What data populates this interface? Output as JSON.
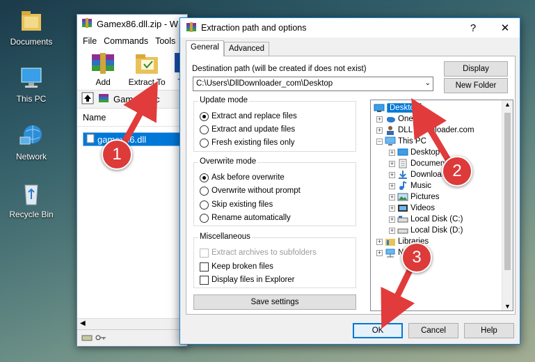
{
  "desktop": {
    "icons": [
      {
        "label": "Documents",
        "icon": "folder-icon"
      },
      {
        "label": "This PC",
        "icon": "computer-icon"
      },
      {
        "label": "Network",
        "icon": "network-icon"
      },
      {
        "label": "Recycle Bin",
        "icon": "recycle-bin-icon"
      }
    ]
  },
  "winrar": {
    "title": "Gamex86.dll.zip - W",
    "menu": [
      "File",
      "Commands",
      "Tools"
    ],
    "toolbar": [
      "Add",
      "Extract To",
      "T"
    ],
    "address": "Gamex86.c",
    "column_name": "Name",
    "file": "gamex86.dll"
  },
  "dialog": {
    "title": "Extraction path and options",
    "help_btn": "?",
    "close_btn": "✕",
    "tabs": [
      "General",
      "Advanced"
    ],
    "dest_label": "Destination path (will be created if does not exist)",
    "dest_value": "C:\\Users\\DllDownloader_com\\Desktop",
    "display_btn": "Display",
    "new_folder_btn": "New Folder",
    "update_mode": {
      "title": "Update mode",
      "options": [
        "Extract and replace files",
        "Extract and update files",
        "Fresh existing files only"
      ],
      "selected": 0
    },
    "overwrite_mode": {
      "title": "Overwrite mode",
      "options": [
        "Ask before overwrite",
        "Overwrite without prompt",
        "Skip existing files",
        "Rename automatically"
      ],
      "selected": 0
    },
    "misc": {
      "title": "Miscellaneous",
      "options": [
        "Extract archives to subfolders",
        "Keep broken files",
        "Display files in Explorer"
      ]
    },
    "save_settings": "Save settings",
    "tree": [
      {
        "label": "Desktop",
        "depth": 0,
        "selected": true
      },
      {
        "label": "OneDrive",
        "depth": 1
      },
      {
        "label": "DLL Downloader.com",
        "depth": 1
      },
      {
        "label": "This PC",
        "depth": 1
      },
      {
        "label": "Desktop",
        "depth": 2
      },
      {
        "label": "Documents",
        "depth": 2
      },
      {
        "label": "Downloads",
        "depth": 2
      },
      {
        "label": "Music",
        "depth": 2
      },
      {
        "label": "Pictures",
        "depth": 2
      },
      {
        "label": "Videos",
        "depth": 2
      },
      {
        "label": "Local Disk (C:)",
        "depth": 2
      },
      {
        "label": "Local Disk (D:)",
        "depth": 2
      },
      {
        "label": "Libraries",
        "depth": 1
      },
      {
        "label": "Network",
        "depth": 1
      }
    ],
    "ok": "OK",
    "cancel": "Cancel",
    "help": "Help"
  },
  "annotations": [
    "1",
    "2",
    "3"
  ],
  "colors": {
    "accent": "#0078d7",
    "badge": "#dd3a3a"
  }
}
